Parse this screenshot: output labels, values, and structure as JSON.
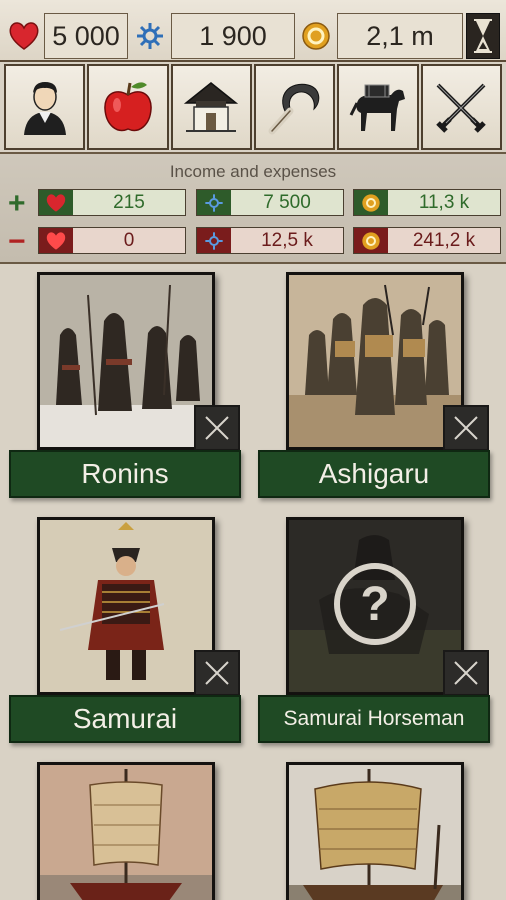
{
  "resources": {
    "health": "5 000",
    "crest": "1 900",
    "gold": "2,1 m"
  },
  "menu": [
    {
      "name": "advisor-menu-button",
      "icon": "person-icon"
    },
    {
      "name": "food-menu-button",
      "icon": "apple-icon"
    },
    {
      "name": "buildings-menu-button",
      "icon": "house-icon"
    },
    {
      "name": "farming-menu-button",
      "icon": "sickle-icon"
    },
    {
      "name": "trade-menu-button",
      "icon": "pack-horse-icon"
    },
    {
      "name": "army-menu-button",
      "icon": "crossed-swords-icon"
    }
  ],
  "income": {
    "title": "Income and expenses",
    "plus": {
      "health": "215",
      "crest": "7 500",
      "gold": "11,3 k"
    },
    "minus": {
      "health": "0",
      "crest": "12,5 k",
      "gold": "241,2 k"
    }
  },
  "units": [
    {
      "label": "Ronins",
      "locked": false
    },
    {
      "label": "Ashigaru",
      "locked": false
    },
    {
      "label": "Samurai",
      "locked": false
    },
    {
      "label": "Samurai Horseman",
      "locked": true
    },
    {
      "label": "",
      "locked": false
    },
    {
      "label": "",
      "locked": false
    }
  ],
  "colors": {
    "heart": "#d8262e",
    "crest": "#2f6fb8",
    "gold": "#e0a020",
    "button_green": "#1f4a24"
  }
}
